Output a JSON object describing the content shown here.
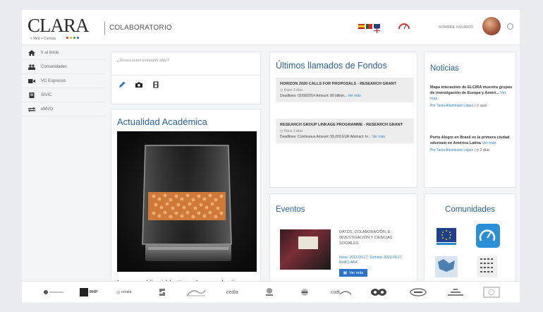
{
  "header": {
    "logo_text": "CLARA",
    "logo_subtitle": "+ Red + Ciencia",
    "app_title": "COLABORATORIO",
    "language_flags": [
      "es-flag",
      "pt-flag",
      "uk-flag"
    ],
    "username": "NOMBRE USUARIO"
  },
  "sidebar": {
    "items": [
      {
        "label": "Ir al inicio",
        "icon": "home-icon"
      },
      {
        "label": "Comunidades",
        "icon": "people-icon"
      },
      {
        "label": "VC Espresso",
        "icon": "video-camera-icon"
      },
      {
        "label": "SIVIC",
        "icon": "document-icon"
      },
      {
        "label": "eMVO",
        "icon": "transfer-icon"
      }
    ]
  },
  "post_box": {
    "placeholder": "¿Desea usted compartir algo?",
    "actions": [
      "pencil-icon",
      "camera-icon",
      "film-icon"
    ]
  },
  "actualidad": {
    "title": "Actualidad Académica",
    "caption": "Improved liquid battery: Longer-lasting"
  },
  "llamados": {
    "title": "Últimos llamados de Fondos",
    "items": [
      {
        "title": "HORIZON 2020 CALLS FOR PROPOSALS - RESEARCH GRANT",
        "time": "Hace 3 días",
        "meta": "Deadlines: 02/09/2014 Amount: 80 billion...",
        "link": "Ver más"
      },
      {
        "title": "RESEARCH GROUP LINKAGE PROGRAMME - RESEARCH GRANT",
        "time": "Hace 3 días",
        "meta": "Deadlines: Continuous Amount: 55,000 EUR Abstract: In...",
        "link": "Ver más"
      }
    ]
  },
  "noticias": {
    "title": "Noticias",
    "items": [
      {
        "title": "Mapa interactivo de ELCIRA muestra grupos de investigación de Europa y Améri...",
        "link": "Ver más",
        "author": "Por Tania Altamirano López",
        "time": "ayer"
      },
      {
        "title": "Porto Alegre en Brasil es la primera ciudad eduroam en América Latina",
        "link": "Ver más",
        "author": "Por Tania Altamirano López",
        "time": "2 días"
      }
    ]
  },
  "eventos": {
    "title": "Eventos",
    "description": "DATOS, COLABORACIÓN, E-INVESTIGACIÓN Y CIENCIAS SOCIALES",
    "dates": "Inicia: 2013-09-17; Termina: 2013-09-17 RedCLARA",
    "button": "Ver más"
  },
  "comunidades": {
    "title": "Comunidades"
  },
  "footer": {
    "partners": [
      "",
      "RNP",
      "renata",
      "",
      "",
      "cedia",
      "",
      "",
      "cudi",
      "",
      "",
      "",
      ""
    ]
  },
  "colors": {
    "accent_blue": "#2a5f9e",
    "link_blue": "#2a7fd0",
    "button_blue": "#2a73c9"
  }
}
